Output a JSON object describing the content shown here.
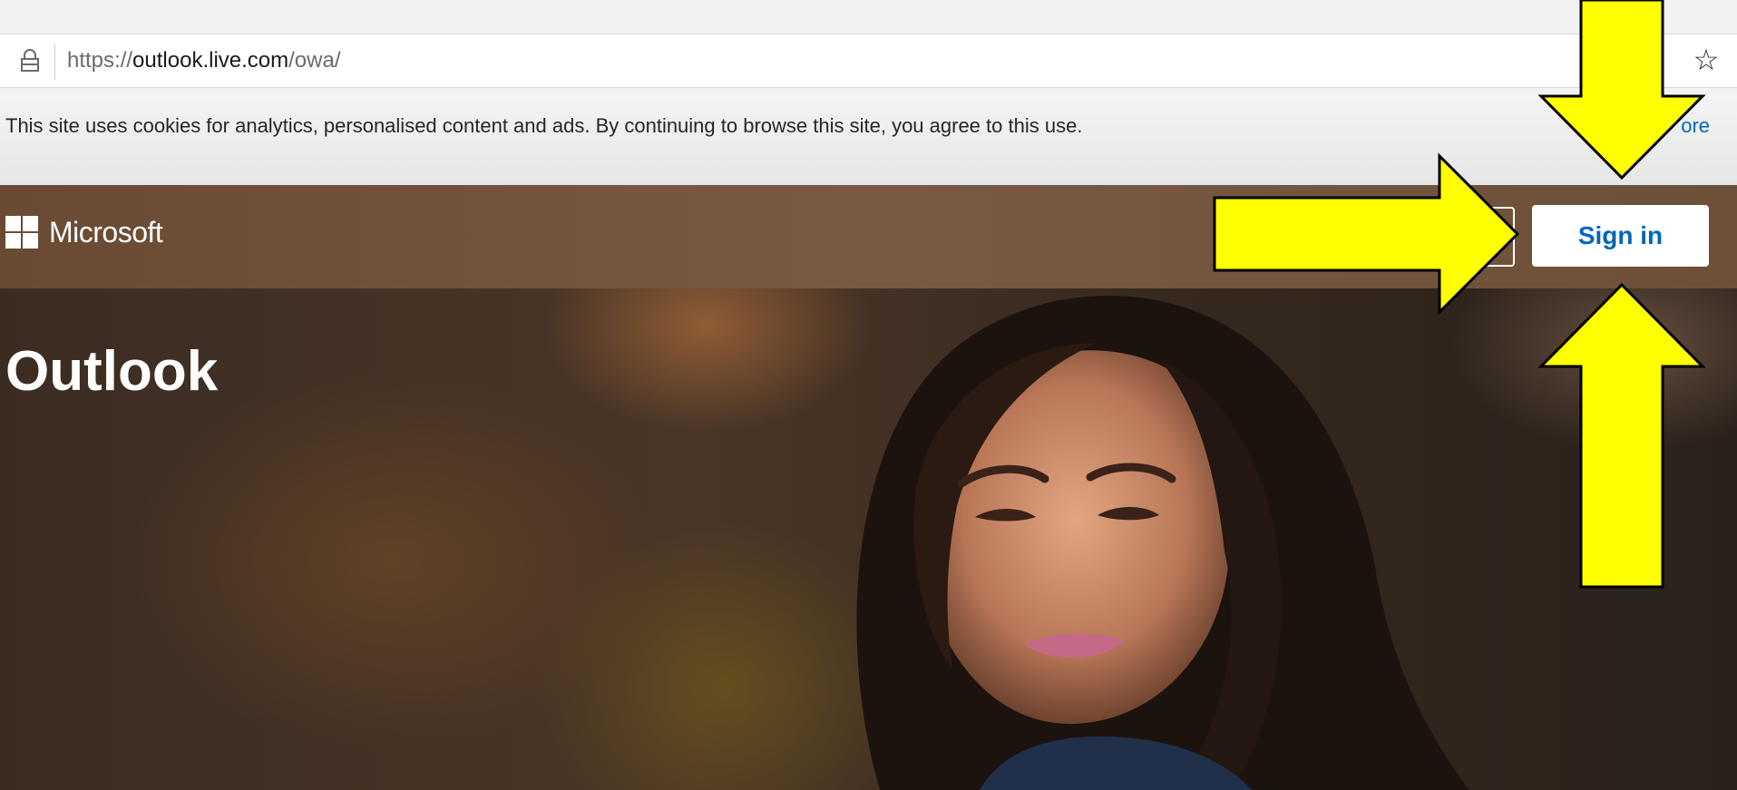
{
  "browser": {
    "url_prefix": "https://",
    "url_domain": "outlook.live.com",
    "url_path": "/owa/",
    "lock_icon": "lock-icon",
    "favorite_icon": "star-icon"
  },
  "cookie_banner": {
    "text": "This site uses cookies for analytics, personalised content and ads. By continuing to browse this site, you agree to this use.",
    "link_text": "ore"
  },
  "header": {
    "brand": "Microsoft",
    "logo_icon": "microsoft-logo-icon",
    "signin_label": "Sign in"
  },
  "hero": {
    "title": "Outlook"
  },
  "annotations": {
    "arrow_color": "#ffff00",
    "arrow_outline": "#000000"
  }
}
